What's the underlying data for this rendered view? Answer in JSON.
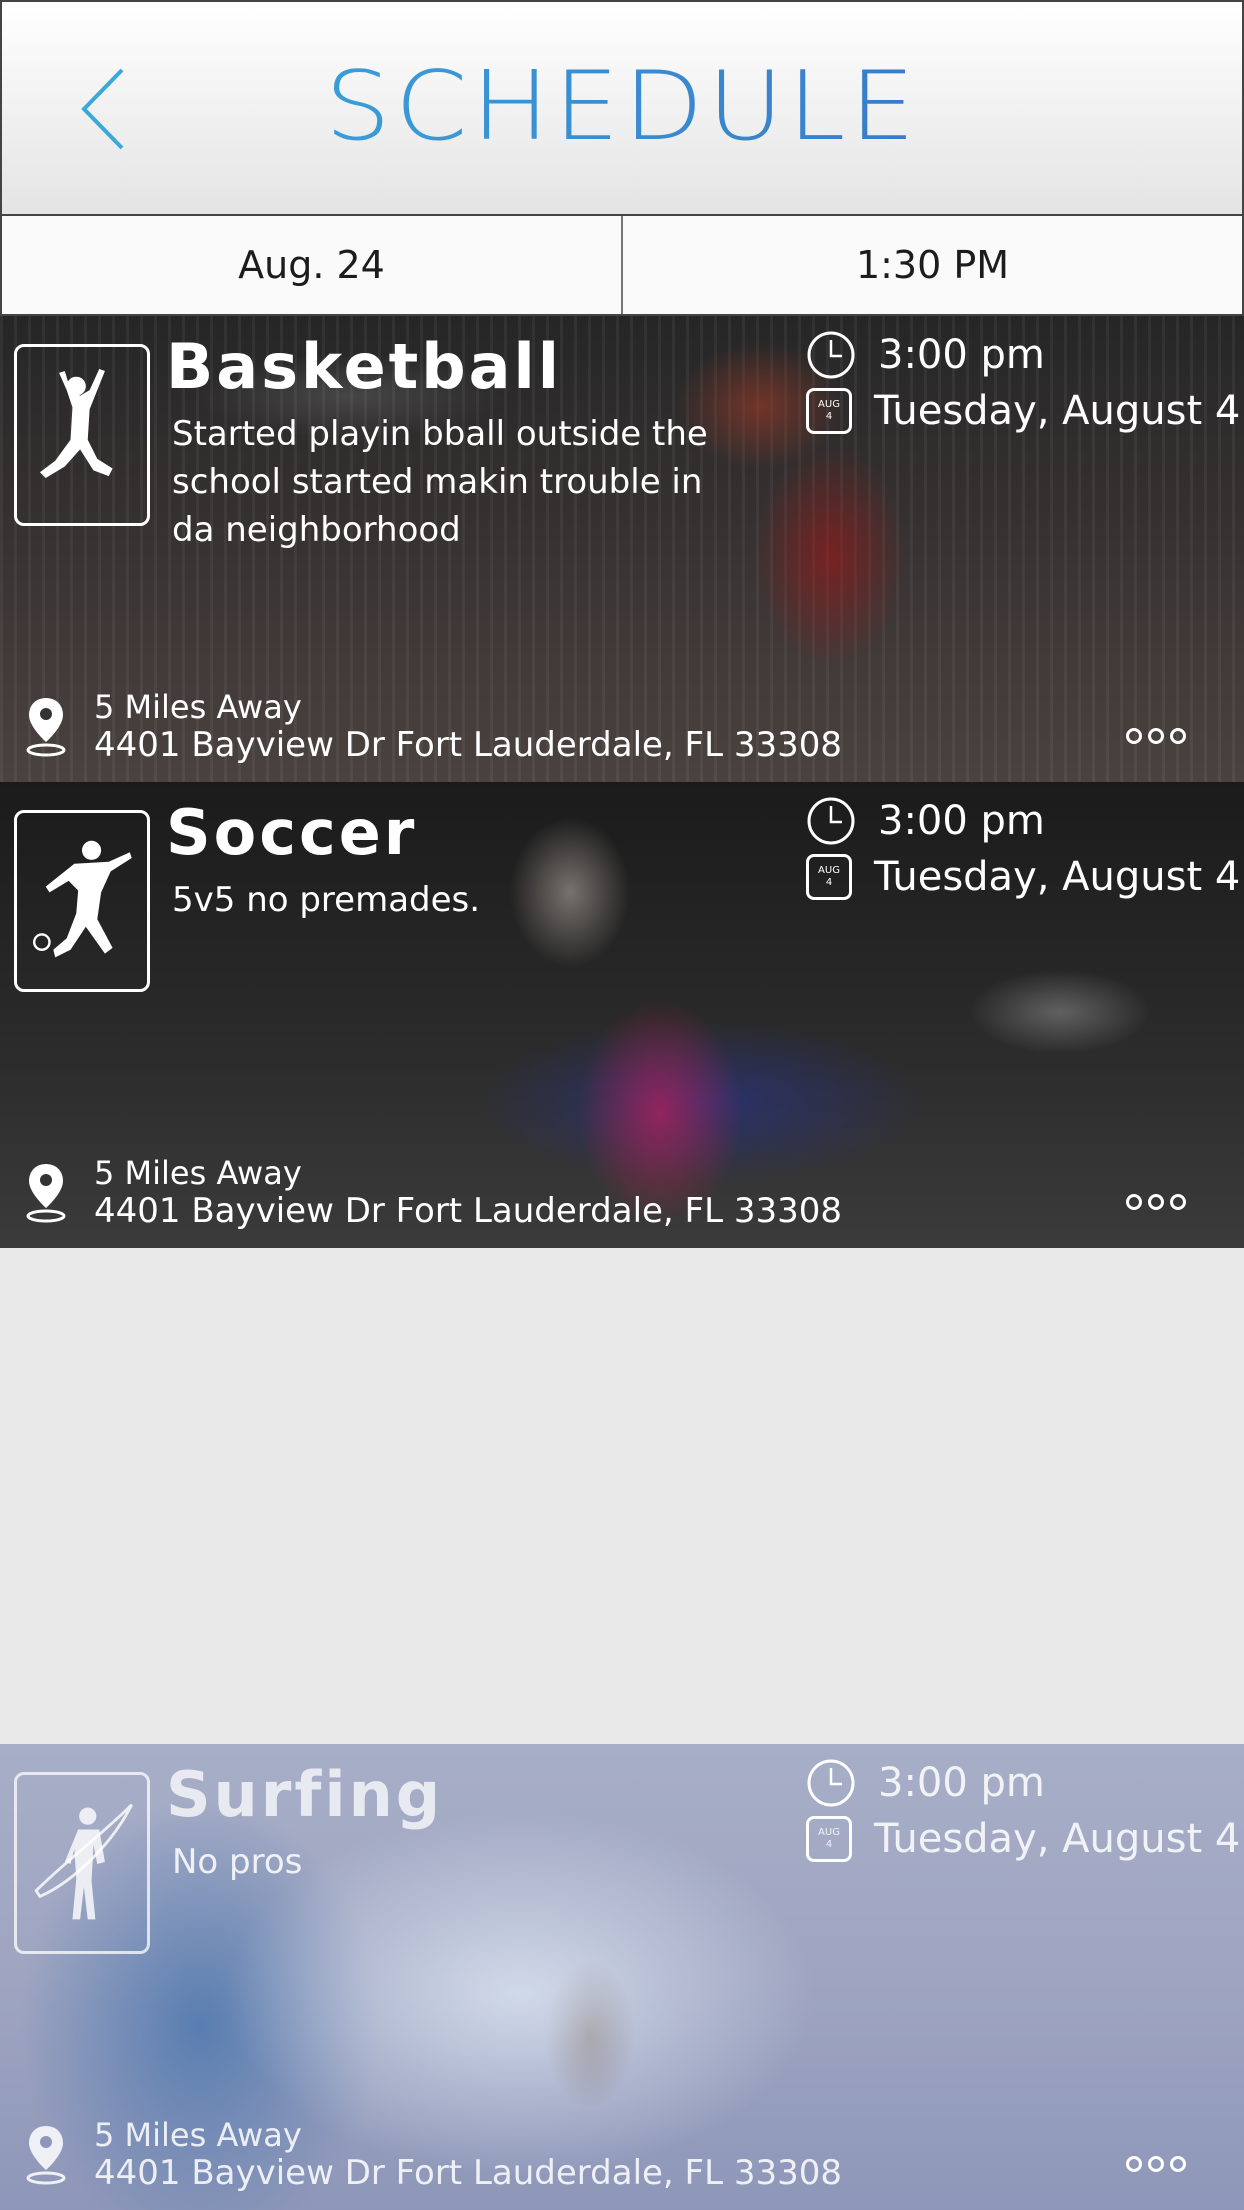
{
  "header": {
    "title": "SCHEDULE"
  },
  "datebar": {
    "date": "Aug. 24",
    "time": "1:30 PM"
  },
  "events": [
    {
      "sport": "Basketball",
      "description": "Started playin bball outside the school started makin trouble in da neighborhood",
      "time": "3:00 pm",
      "day": "Tuesday, August 4",
      "cal_month": "AUG",
      "cal_day": "4",
      "distance": "5 Miles Away",
      "address": "4401 Bayview Dr Fort Lauderdale, FL 33308"
    },
    {
      "sport": "Soccer",
      "description": "5v5 no premades.",
      "time": "3:00 pm",
      "day": "Tuesday, August 4",
      "cal_month": "AUG",
      "cal_day": "4",
      "distance": "5 Miles Away",
      "address": "4401 Bayview Dr Fort Lauderdale, FL 33308"
    },
    {
      "sport": "Surfing",
      "description": "No pros",
      "time": "3:00 pm",
      "day": "Tuesday, August 4",
      "cal_month": "AUG",
      "cal_day": "4",
      "distance": "5 Miles Away",
      "address": "4401 Bayview Dr Fort Lauderdale, FL 33308"
    }
  ]
}
